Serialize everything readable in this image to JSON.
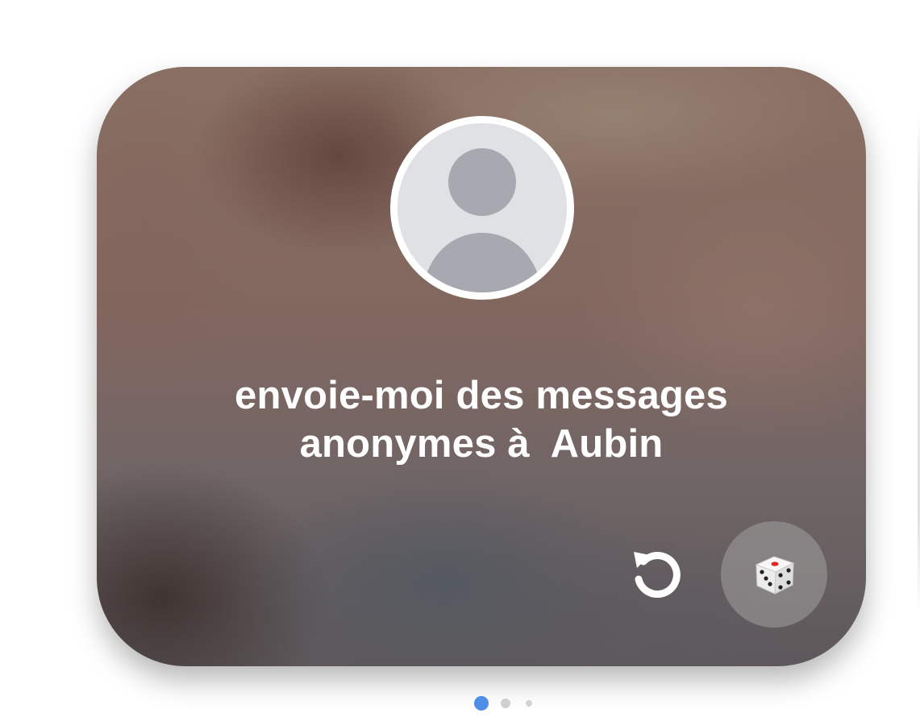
{
  "card": {
    "headline_line1": "envoie-moi des messages",
    "headline_line2": "anonymes à  Aubin",
    "avatar_icon": "default-user-avatar-icon"
  },
  "controls": {
    "refresh_icon": "refresh-icon",
    "dice_icon": "dice-icon"
  },
  "pager": {
    "page_count": 3,
    "active_page": 1,
    "active_color": "#4f8ee8",
    "inactive_color": "#cfcfcf"
  }
}
